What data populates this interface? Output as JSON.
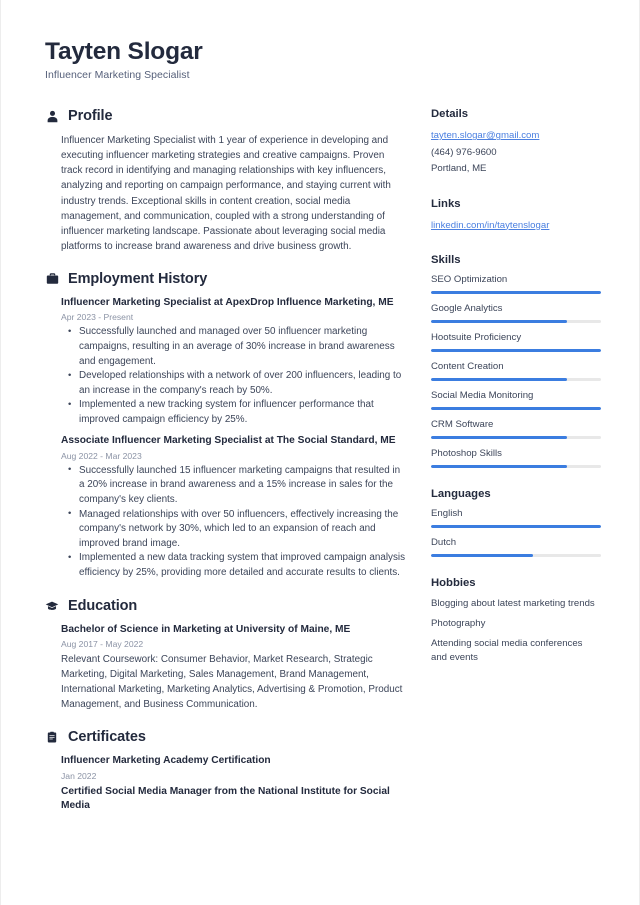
{
  "accent_color": "#3b7de0",
  "header": {
    "full_name": "Tayten Slogar",
    "job_title": "Influencer Marketing Specialist"
  },
  "profile": {
    "heading": "Profile",
    "icon": "person-icon",
    "text": "Influencer Marketing Specialist with 1 year of experience in developing and executing influencer marketing strategies and creative campaigns. Proven track record in identifying and managing relationships with key influencers, analyzing and reporting on campaign performance, and staying current with industry trends. Exceptional skills in content creation, social media management, and communication, coupled with a strong understanding of influencer marketing landscape. Passionate about leveraging social media platforms to increase brand awareness and drive business growth."
  },
  "employment": {
    "heading": "Employment History",
    "icon": "briefcase-icon",
    "entries": [
      {
        "title": "Influencer Marketing Specialist at ApexDrop Influence Marketing, ME",
        "date": "Apr 2023 - Present",
        "bullets": [
          "Successfully launched and managed over 50 influencer marketing campaigns, resulting in an average of 30% increase in brand awareness and engagement.",
          "Developed relationships with a network of over 200 influencers, leading to an increase in the company's reach by 50%.",
          "Implemented a new tracking system for influencer performance that improved campaign efficiency by 25%."
        ]
      },
      {
        "title": "Associate Influencer Marketing Specialist at The Social Standard, ME",
        "date": "Aug 2022 - Mar 2023",
        "bullets": [
          "Successfully launched 15 influencer marketing campaigns that resulted in a 20% increase in brand awareness and a 15% increase in sales for the company's key clients.",
          "Managed relationships with over 50 influencers, effectively increasing the company's network by 30%, which led to an expansion of reach and improved brand image.",
          "Implemented a new data tracking system that improved campaign analysis efficiency by 25%, providing more detailed and accurate results to clients."
        ]
      }
    ]
  },
  "education": {
    "heading": "Education",
    "icon": "graduation-cap-icon",
    "entries": [
      {
        "title": "Bachelor of Science in Marketing at University of Maine, ME",
        "date": "Aug 2017 - May 2022",
        "description": "Relevant Coursework: Consumer Behavior, Market Research, Strategic Marketing, Digital Marketing, Sales Management, Brand Management, International Marketing, Marketing Analytics, Advertising & Promotion, Product Management, and Business Communication."
      }
    ]
  },
  "certificates": {
    "heading": "Certificates",
    "icon": "certificate-icon",
    "entries": [
      {
        "title": "Influencer Marketing Academy Certification",
        "date": "Jan 2022"
      },
      {
        "title": "Certified Social Media Manager from the National Institute for Social Media",
        "date": ""
      }
    ]
  },
  "details": {
    "heading": "Details",
    "email": "tayten.slogar@gmail.com",
    "phone": "(464) 976-9600",
    "location": "Portland, ME"
  },
  "links": {
    "heading": "Links",
    "items": [
      {
        "label": "linkedin.com/in/taytenslogar"
      }
    ]
  },
  "skills": {
    "heading": "Skills",
    "items": [
      {
        "label": "SEO Optimization",
        "level": 100
      },
      {
        "label": "Google Analytics",
        "level": 80
      },
      {
        "label": "Hootsuite Proficiency",
        "level": 100
      },
      {
        "label": "Content Creation",
        "level": 80
      },
      {
        "label": "Social Media Monitoring",
        "level": 100
      },
      {
        "label": "CRM Software",
        "level": 80
      },
      {
        "label": "Photoshop Skills",
        "level": 80
      }
    ]
  },
  "languages": {
    "heading": "Languages",
    "items": [
      {
        "label": "English",
        "level": 100
      },
      {
        "label": "Dutch",
        "level": 60
      }
    ]
  },
  "hobbies": {
    "heading": "Hobbies",
    "items": [
      "Blogging about latest marketing trends",
      "Photography",
      "Attending social media conferences and events"
    ]
  }
}
